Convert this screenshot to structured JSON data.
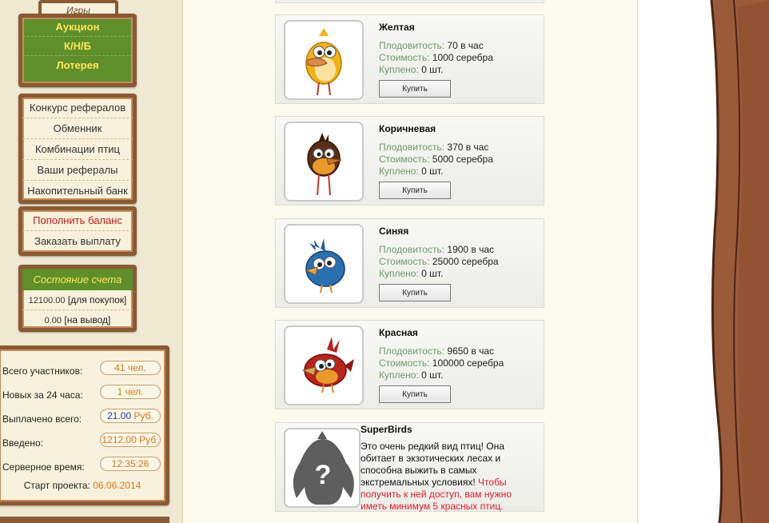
{
  "sidebar": {
    "games_tab": "Игры",
    "games": [
      "Аукцион",
      "К/Н/Б",
      "Лотерея"
    ],
    "menu": [
      "Конкурс рефералов",
      "Обменник",
      "Комбинации птиц",
      "Ваши рефералы",
      "Накопительный банк"
    ],
    "pay": {
      "topup": "Пополнить баланс",
      "withdraw": "Заказать выплату"
    },
    "account": {
      "title": "Состояние счета",
      "purchase_value": "12100.00",
      "purchase_label": "[для покупок]",
      "withdraw_value": "0.00",
      "withdraw_label": "[на вывод]"
    },
    "stats": {
      "total_label": "Всего участников:",
      "total_value": "41 чел.",
      "new_label": "Новых за 24 часа:",
      "new_value": "1 чел.",
      "paid_label": "Выплачено всего:",
      "paid_value": "21.00",
      "paid_unit": "Руб.",
      "deposited_label": "Введено:",
      "deposited_value": "1212.00 Руб.",
      "server_time_label": "Серверное время:",
      "server_time_value": "12:35:26",
      "start_label": "Старт проекта:",
      "start_value": "06.06.2014"
    }
  },
  "labels": {
    "fertility": "Плодовитость:",
    "cost": "Стоимость:",
    "bought": "Куплено:",
    "buy_button": "Купить"
  },
  "birds": [
    {
      "name": "Желтая",
      "fertility": "70 в час",
      "cost": "1000 серебра",
      "bought": "0 шт.",
      "color": "#f2b21c"
    },
    {
      "name": "Коричневая",
      "fertility": "370 в час",
      "cost": "5000 серебра",
      "bought": "0 шт.",
      "color": "#5a2f1a"
    },
    {
      "name": "Синяя",
      "fertility": "1900 в час",
      "cost": "25000 серебра",
      "bought": "0 шт.",
      "color": "#2a6fb0"
    },
    {
      "name": "Красная",
      "fertility": "9650 в час",
      "cost": "100000 серебра",
      "bought": "0 шт.",
      "color": "#b8231e"
    }
  ],
  "superbirds": {
    "name": "SuperBirds",
    "description": "Это очень редкий вид птиц! Она обитает в экзотических лесах и способна выжить в самых экстремальных условиях!",
    "requirement": "Чтобы получить к ней доступ, вам нужно иметь минимум 5 красных птиц."
  },
  "colors": {
    "wood": "#8a5a34",
    "green_panel": "#5f8f2a",
    "accent_orange": "#e0741c",
    "tree_bark": "#9b5a3a"
  }
}
